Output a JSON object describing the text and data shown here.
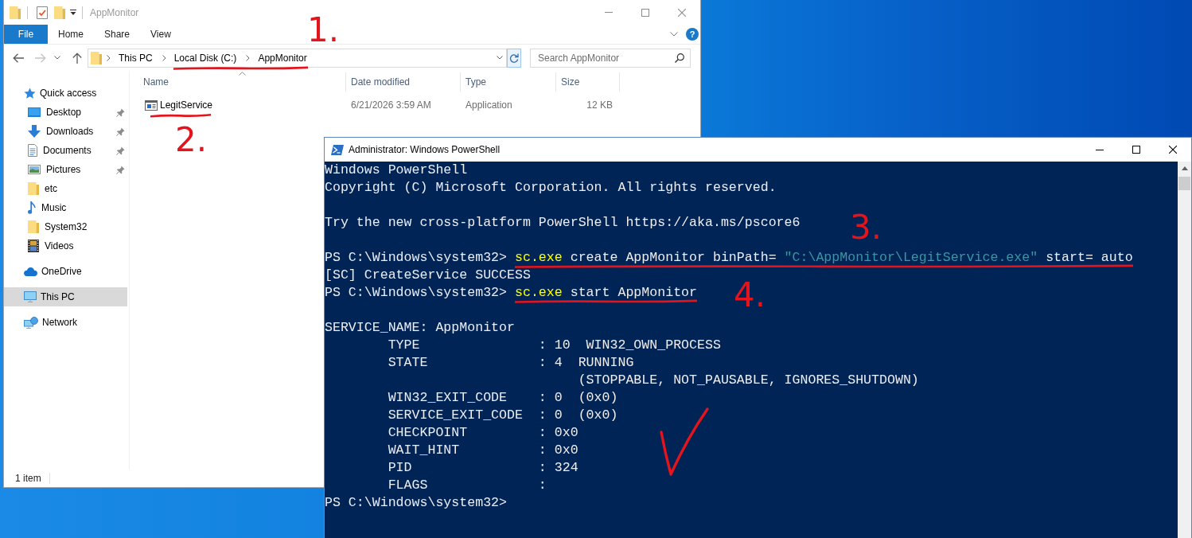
{
  "explorer": {
    "window": {
      "title": "AppMonitor",
      "active": false
    },
    "ribbon": {
      "tabs": [
        {
          "label": "File",
          "kind": "menu",
          "selected": false
        },
        {
          "label": "Home",
          "kind": "tab",
          "selected": false
        },
        {
          "label": "Share",
          "kind": "tab",
          "selected": false
        },
        {
          "label": "View",
          "kind": "tab",
          "selected": false
        }
      ],
      "help": "?"
    },
    "history_buttons": [
      {
        "disabled": false
      },
      {
        "disabled": true
      }
    ],
    "address": {
      "breadcrumbs": [
        {
          "label": "This PC",
          "underlined": false
        },
        {
          "label": "Local Disk (C:)",
          "underlined": true
        },
        {
          "label": "AppMonitor",
          "underlined": true
        }
      ]
    },
    "search": {
      "placeholder": "Search AppMonitor"
    },
    "nav_pane": {
      "items": [
        {
          "label": "Quick access",
          "selected": false,
          "children": [
            {
              "label": "Desktop",
              "pinned": true,
              "selected": false
            },
            {
              "label": "Downloads",
              "pinned": true,
              "selected": false
            },
            {
              "label": "Documents",
              "pinned": true,
              "selected": false
            },
            {
              "label": "Pictures",
              "pinned": true,
              "selected": false
            },
            {
              "label": "etc",
              "pinned": false,
              "selected": false
            },
            {
              "label": "Music",
              "pinned": false,
              "selected": false
            },
            {
              "label": "System32",
              "pinned": false,
              "selected": false
            },
            {
              "label": "Videos",
              "pinned": false,
              "selected": false
            }
          ]
        },
        {
          "label": "OneDrive",
          "selected": false
        },
        {
          "label": "This PC",
          "selected": true
        },
        {
          "label": "Network",
          "selected": false
        }
      ]
    },
    "file_list": {
      "columns": [
        {
          "label": "Name",
          "sorted": true
        },
        {
          "label": "Date modified",
          "sorted": false
        },
        {
          "label": "Type",
          "sorted": false
        },
        {
          "label": "Size",
          "sorted": false
        }
      ],
      "rows": [
        {
          "cells": [
            "LegitService",
            "6/21/2026 3:59 AM",
            "Application",
            "12 KB"
          ],
          "selected": false,
          "underlined": true
        }
      ]
    },
    "status_bar": {
      "text": "1 item"
    }
  },
  "powershell": {
    "window": {
      "title": "Administrator: Windows PowerShell",
      "active": true
    },
    "console": {
      "blocks": [
        {
          "lines": [
            {
              "kind": "text",
              "text": "Windows PowerShell"
            },
            {
              "kind": "text",
              "text": "Copyright (C) Microsoft Corporation. All rights reserved."
            }
          ]
        },
        {
          "lines": [
            {
              "kind": "text",
              "text": "Try the new cross-platform PowerShell https://aka.ms/pscore6"
            }
          ]
        },
        {
          "lines": [
            {
              "kind": "command",
              "prompt": "PS C:\\Windows\\system32>",
              "segments": [
                {
                  "kind": "program",
                  "text": "sc.exe"
                },
                {
                  "kind": "plain",
                  "text": "create AppMonitor binPath="
                },
                {
                  "kind": "string",
                  "text": "\"C:\\AppMonitor\\LegitService.exe\""
                },
                {
                  "kind": "plain",
                  "text": "start= auto"
                }
              ],
              "underlined": true
            },
            {
              "kind": "text",
              "text": "[SC] CreateService SUCCESS"
            },
            {
              "kind": "command",
              "prompt": "PS C:\\Windows\\system32>",
              "segments": [
                {
                  "kind": "program",
                  "text": "sc.exe"
                },
                {
                  "kind": "plain",
                  "text": "start AppMonitor"
                }
              ],
              "underlined": true
            }
          ]
        },
        {
          "lines": [
            {
              "kind": "text",
              "text": "SERVICE_NAME: AppMonitor"
            },
            {
              "kind": "field",
              "name": "TYPE",
              "value": ": 10  WIN32_OWN_PROCESS"
            },
            {
              "kind": "field",
              "name": "STATE",
              "value": ": 4  RUNNING"
            },
            {
              "kind": "continuation",
              "text": "(STOPPABLE, NOT_PAUSABLE, IGNORES_SHUTDOWN)"
            },
            {
              "kind": "field",
              "name": "WIN32_EXIT_CODE",
              "value": ": 0  (0x0)"
            },
            {
              "kind": "field",
              "name": "SERVICE_EXIT_CODE",
              "value": ": 0  (0x0)"
            },
            {
              "kind": "field",
              "name": "CHECKPOINT",
              "value": ": 0x0"
            },
            {
              "kind": "field",
              "name": "WAIT_HINT",
              "value": ": 0x0"
            },
            {
              "kind": "field",
              "name": "PID",
              "value": ": 324"
            },
            {
              "kind": "field",
              "name": "FLAGS",
              "value": ":"
            },
            {
              "kind": "command",
              "prompt": "PS C:\\Windows\\system32>"
            }
          ]
        }
      ]
    }
  },
  "annotations": [
    {
      "kind": "number",
      "text": "1."
    },
    {
      "kind": "number",
      "text": "2."
    },
    {
      "kind": "number",
      "text": "3."
    },
    {
      "kind": "number",
      "text": "4."
    },
    {
      "kind": "tick"
    }
  ]
}
